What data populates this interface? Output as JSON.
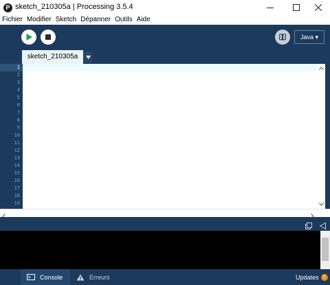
{
  "window": {
    "title": "sketch_210305a | Processing 3.5.4",
    "app_icon_glyph": "P"
  },
  "menu": [
    "Fichier",
    "Modifier",
    "Sketch",
    "Dépanner",
    "Outils",
    "Aide"
  ],
  "toolbar": {
    "mode_label": "Java ▾"
  },
  "tabs": [
    {
      "label": "sketch_210305a"
    }
  ],
  "editor": {
    "line_numbers": [
      "1",
      "2",
      "3",
      "4",
      "5",
      "6",
      "7",
      "8",
      "9",
      "10",
      "11",
      "12",
      "13",
      "14",
      "15",
      "16",
      "17",
      "18",
      "19"
    ],
    "current_line": 1
  },
  "footer": {
    "console_label": "Console",
    "errors_label": "Erreurs",
    "updates_label": "Updates",
    "updates_count": "2"
  },
  "colors": {
    "toolbar_bg": "#1c3a5c",
    "run_green": "#1ba54b",
    "current_line": "#ecfcfd",
    "badge": "#e38a1f"
  }
}
